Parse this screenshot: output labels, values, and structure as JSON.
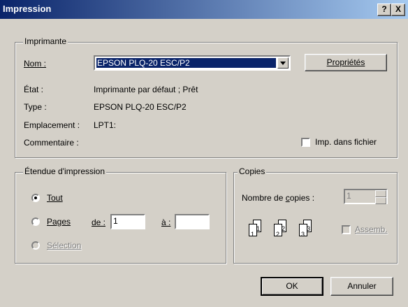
{
  "window": {
    "title": "Impression",
    "help_btn": "?",
    "close_btn": "X"
  },
  "printer": {
    "group_label": "Imprimante",
    "name_label": "Nom :",
    "name_value": "EPSON PLQ-20 ESC/P2",
    "properties_btn": "Propriétés",
    "state_label": "État :",
    "state_value": "Imprimante par défaut ; Prêt",
    "type_label": "Type :",
    "type_value": "EPSON PLQ-20 ESC/P2",
    "location_label": "Emplacement :",
    "location_value": "LPT1:",
    "comment_label": "Commentaire :",
    "print_to_file": "Imp. dans fichier"
  },
  "range": {
    "group_label": "Étendue d'impression",
    "all": "Tout",
    "pages": "Pages",
    "from_label": "de :",
    "from_value": "1",
    "to_label": "à :",
    "to_value": "",
    "selection": "Sélection"
  },
  "copies": {
    "group_label": "Copies",
    "count_label": "Nombre de copies :",
    "count_value": "1",
    "collate": "Assemb.",
    "icon_nums": [
      "1",
      "1",
      "2",
      "2",
      "3",
      "3"
    ]
  },
  "buttons": {
    "ok": "OK",
    "cancel": "Annuler"
  }
}
